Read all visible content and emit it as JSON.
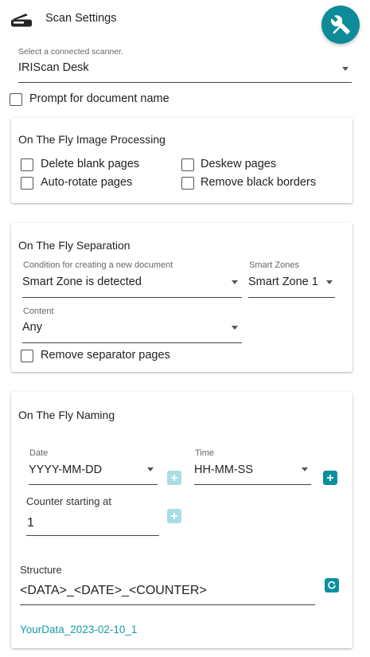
{
  "header": {
    "title": "Scan Settings",
    "icon": "scanner-icon",
    "action_icon": "tools-icon",
    "accent_color": "#0e8b99"
  },
  "scanner": {
    "label": "Select a connected scanner.",
    "value": "IRIScan Desk"
  },
  "prompt_doc_name": {
    "label": "Prompt for document name",
    "checked": false
  },
  "image_processing": {
    "title": "On The Fly Image Processing",
    "options": [
      {
        "label": "Delete blank pages",
        "checked": false
      },
      {
        "label": "Deskew pages",
        "checked": false
      },
      {
        "label": "Auto-rotate pages",
        "checked": false
      },
      {
        "label": "Remove black borders",
        "checked": false
      }
    ]
  },
  "separation": {
    "title": "On The Fly Separation",
    "condition": {
      "label": "Condition for creating a new document",
      "value": "Smart Zone is detected"
    },
    "smart_zones": {
      "label": "Smart Zones",
      "value": "Smart Zone 1"
    },
    "content": {
      "label": "Content",
      "value": "Any"
    },
    "remove_separator": {
      "label": "Remove separator pages",
      "checked": false
    }
  },
  "naming": {
    "title": "On The Fly Naming",
    "date": {
      "label": "Date",
      "value": "YYYY-MM-DD"
    },
    "time": {
      "label": "Time",
      "value": "HH-MM-SS"
    },
    "counter": {
      "label": "Counter starting at",
      "value": "1"
    },
    "structure": {
      "label": "Structure",
      "value": "<DATA>_<DATE>_<COUNTER>"
    },
    "preview": "YourData_2023-02-10_1"
  }
}
